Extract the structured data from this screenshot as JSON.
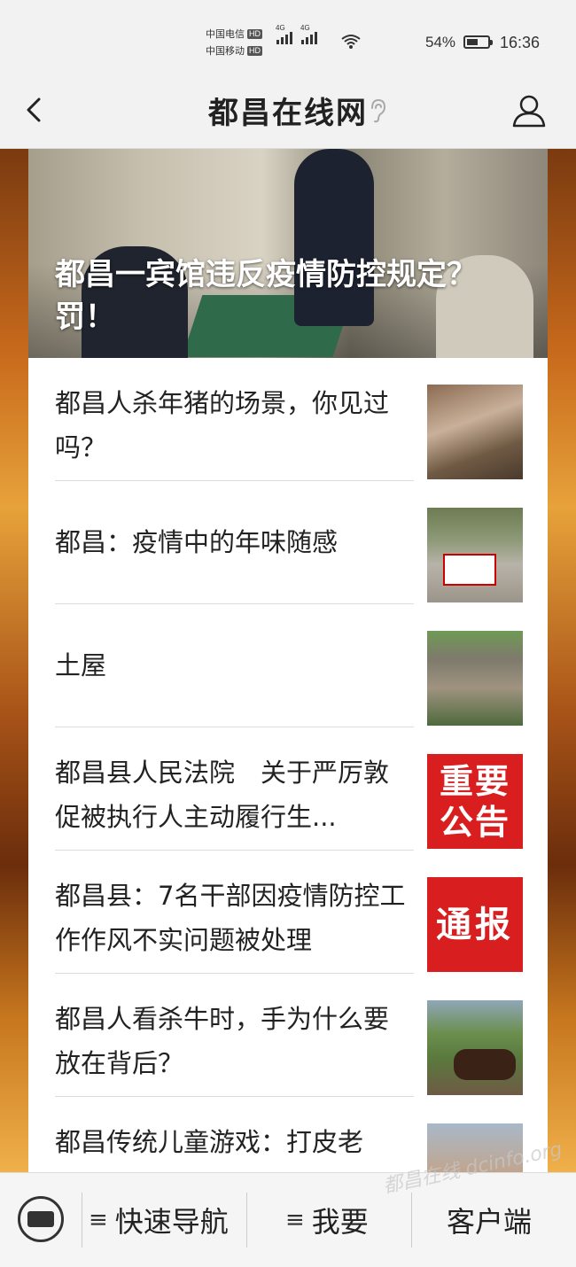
{
  "status_bar": {
    "carrier1": "中国电信",
    "carrier2": "中国移动",
    "hd": "HD",
    "net_label": "4G",
    "battery_text": "54%",
    "battery_level": 0.54,
    "time": "16:36"
  },
  "header": {
    "title": "都昌在线网"
  },
  "hero": {
    "title": "都昌一宾馆违反疫情防控规定？罚！"
  },
  "news": [
    {
      "title": "都昌人杀年猪的场景，你见过吗？",
      "thumb": "pig-thumbnail"
    },
    {
      "title": "都昌：疫情中的年味随感",
      "thumb": "road-thumbnail"
    },
    {
      "title": "土屋",
      "thumb": "house-thumbnail"
    },
    {
      "title": "都昌县人民法院　关于严厉敦促被执行人主动履行生...",
      "thumb": "notice-thumbnail",
      "thumb_text": [
        "重要",
        "公告"
      ]
    },
    {
      "title": "都昌县：7名干部因疫情防控工作作风不实问题被处理",
      "thumb": "report-thumbnail",
      "thumb_text": [
        "通报"
      ]
    },
    {
      "title": "都昌人看杀牛时，手为什么要放在背后？",
      "thumb": "cow-thumbnail"
    },
    {
      "title": "都昌传统儿童游戏：打皮老",
      "thumb": "kids-thumbnail"
    }
  ],
  "bottom_nav": {
    "quick_nav": "快速导航",
    "want": "我要",
    "client": "客户端",
    "menu_glyph": "≡"
  },
  "watermark": "都昌在线 dcinfo.org"
}
